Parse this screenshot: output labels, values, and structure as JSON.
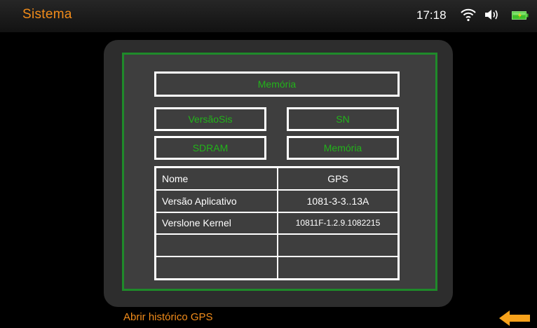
{
  "header": {
    "title": "Sistema",
    "time": "17:18"
  },
  "buttons": {
    "memoria_top": "Memória",
    "versaosis": "VersãoSis",
    "sn": "SN",
    "sdram": "SDRAM",
    "memoria": "Memória"
  },
  "table": {
    "rows": [
      {
        "label": "Nome",
        "value": "GPS"
      },
      {
        "label": "Versão Aplicativo",
        "value": "1081-3-3..13A"
      },
      {
        "label": "Verslone Kernel",
        "value": "10811F-1.2.9.1082215"
      },
      {
        "label": "",
        "value": ""
      },
      {
        "label": "",
        "value": ""
      }
    ]
  },
  "footer": {
    "history_link": "Abrir histórico GPS"
  },
  "icons": {
    "wifi": "wifi-icon",
    "volume": "volume-icon",
    "battery": "battery-icon",
    "back": "back-arrow-icon"
  },
  "colors": {
    "accent_orange": "#f28c1a",
    "text_green": "#22b41a",
    "frame_green": "#1f8a2a"
  }
}
